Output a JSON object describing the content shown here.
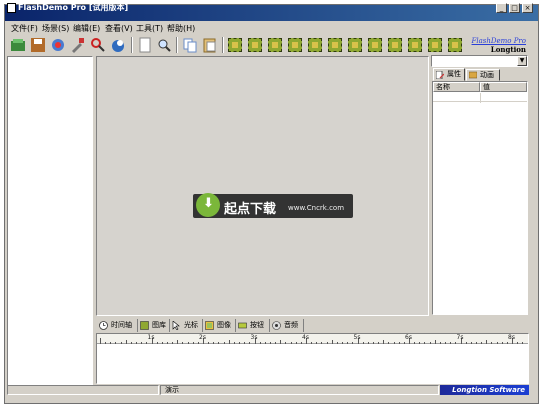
{
  "window": {
    "title": "FlashDemo Pro [试用版本]"
  },
  "window_buttons": {
    "minimize": "_",
    "maximize": "□",
    "close": "×"
  },
  "menu": [
    {
      "label": "文件(F)"
    },
    {
      "label": "场景(S)"
    },
    {
      "label": "编辑(E)"
    },
    {
      "label": "查看(V)"
    },
    {
      "label": "工具(T)"
    },
    {
      "label": "帮助(H)"
    }
  ],
  "toolbar": {
    "icons": [
      "open-recording-icon",
      "save-icon",
      "record-icon",
      "tools-icon",
      "find-icon",
      "publish-icon",
      "new-doc-icon",
      "zoom-icon",
      "copy-icon",
      "paste-icon"
    ],
    "frame_icons_count_label": "",
    "brand_line1": "FlashDemo Pro",
    "brand_line2": "Longtion"
  },
  "watermark": {
    "text": "起点下载",
    "url": "www.Cncrk.com"
  },
  "right_panel": {
    "combo_value": "",
    "tabs": [
      {
        "label": "属性"
      },
      {
        "label": "动画"
      }
    ],
    "columns": [
      "名称",
      "值"
    ]
  },
  "timeline": {
    "tabs": [
      {
        "label": "时间轴",
        "icon": "clock-icon"
      },
      {
        "label": "图库",
        "icon": "gallery-icon"
      },
      {
        "label": "光标",
        "icon": "cursor-icon"
      },
      {
        "label": "图像",
        "icon": "image-icon"
      },
      {
        "label": "按钮",
        "icon": "button-icon"
      },
      {
        "label": "音频",
        "icon": "audio-icon"
      }
    ],
    "ruler_labels": [
      "1s",
      "2s",
      "3s",
      "4s",
      "5s",
      "6s",
      "7s",
      "8s"
    ]
  },
  "status": {
    "left": "",
    "middle": "演示",
    "brand": "Longtion Software"
  },
  "colors": {
    "title_start": "#0a246a",
    "title_end": "#3a6ea5",
    "face": "#d4d0c8",
    "stage": "#d6d3ce",
    "brand_blue": "#1b3fd3"
  }
}
